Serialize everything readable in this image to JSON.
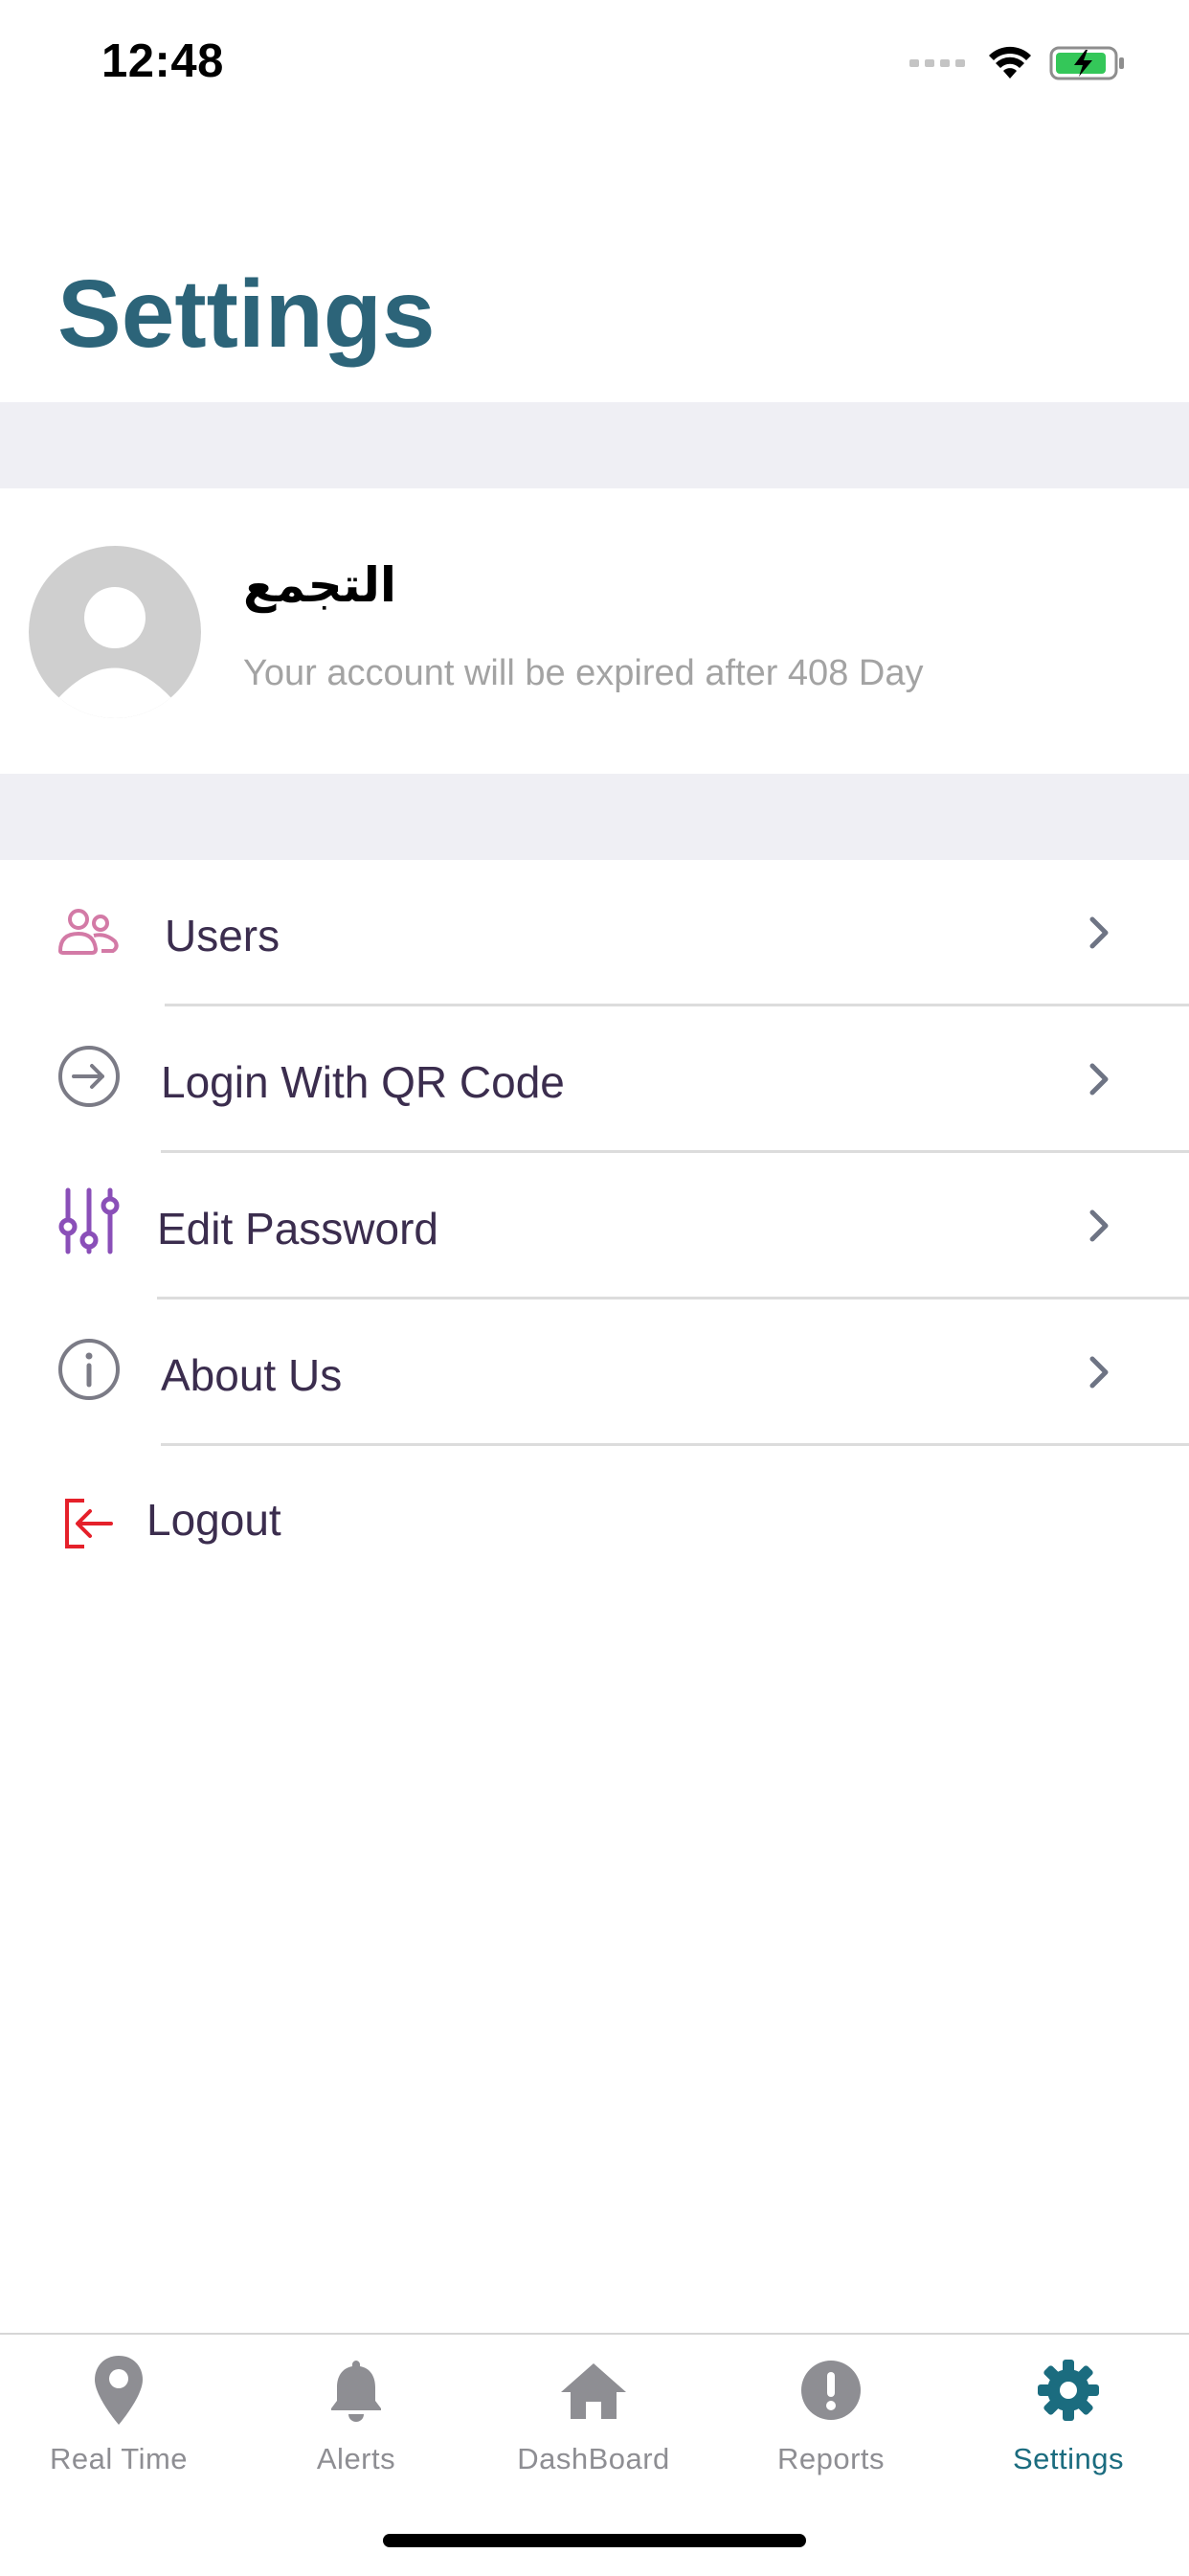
{
  "status_bar": {
    "time": "12:48"
  },
  "header": {
    "title": "Settings",
    "title_color": "#2c6479"
  },
  "profile": {
    "name": "التجمع",
    "expiry_text": "Your account will be expired after 408 Day"
  },
  "menu": {
    "items": [
      {
        "label": "Users",
        "icon": "users-icon",
        "icon_color": "#d37aa6"
      },
      {
        "label": "Login With QR Code",
        "icon": "arrow-circle-right-icon",
        "icon_color": "#7b7b86"
      },
      {
        "label": "Edit Password",
        "icon": "sliders-icon",
        "icon_color": "#8a4fb8"
      },
      {
        "label": "About Us",
        "icon": "info-icon",
        "icon_color": "#7b7b86"
      }
    ],
    "logout": {
      "label": "Logout",
      "icon": "logout-icon",
      "icon_color": "#e5202a"
    }
  },
  "tab_bar": {
    "tabs": [
      {
        "label": "Real Time",
        "icon": "map-pin-icon"
      },
      {
        "label": "Alerts",
        "icon": "bell-icon"
      },
      {
        "label": "DashBoard",
        "icon": "home-icon"
      },
      {
        "label": "Reports",
        "icon": "exclamation-circle-icon"
      },
      {
        "label": "Settings",
        "icon": "gear-icon",
        "active": true
      }
    ],
    "inactive_color": "#8e8e93",
    "active_color": "#1b6c7f"
  }
}
